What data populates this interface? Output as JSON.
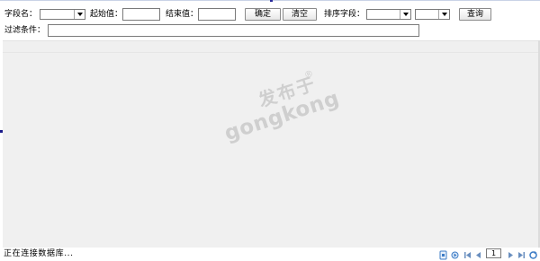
{
  "filter": {
    "field_name_label": "字段名：",
    "start_value_label": "起始值：",
    "end_value_label": "结束值：",
    "confirm_button": "确定",
    "clear_button": "清空",
    "sort_field_label": "排序字段：",
    "query_button": "查询",
    "filter_condition_label": "过滤条件：",
    "field_name_value": "",
    "start_value": "",
    "end_value": "",
    "sort_field_value": "",
    "sort_order_value": "",
    "filter_condition_value": ""
  },
  "watermark": {
    "cn": "发布于",
    "en": "gongkong",
    "reg": "®"
  },
  "status": {
    "text": "正在连接数据库..."
  },
  "pager": {
    "page_number": "1"
  },
  "colors": {
    "grid_background": "#f0f0f0",
    "watermark": "#cfcfcf",
    "pager_icon": "#3c7cc6"
  }
}
